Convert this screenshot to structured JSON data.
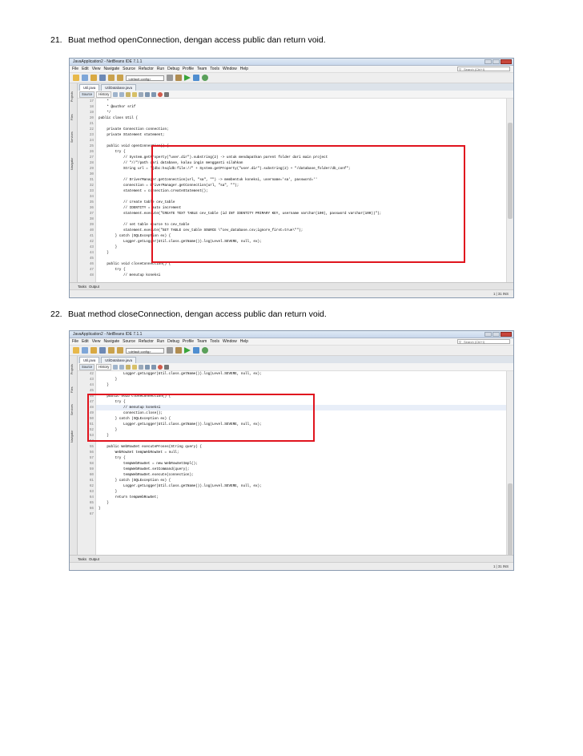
{
  "steps": [
    {
      "number": "21.",
      "text": "Buat method openConnection, dengan access public dan return void."
    },
    {
      "number": "22.",
      "text": "Buat method closeConnection, dengan access public dan return void."
    }
  ],
  "ide": {
    "title": "JavaApplication2 - NetBeans IDE 7.1.1",
    "menu": [
      "File",
      "Edit",
      "View",
      "Navigate",
      "Source",
      "Refactor",
      "Run",
      "Debug",
      "Profile",
      "Team",
      "Tools",
      "Window",
      "Help"
    ],
    "search_placeholder": "Search (Ctrl+I)",
    "config": "<default config>",
    "side_tabs": [
      "Projects",
      "Files",
      "Services",
      "Navigator"
    ],
    "editor_buttons": [
      "Source",
      "History"
    ],
    "bottom_tabs": [
      "Tasks",
      "Output"
    ],
    "colors": {
      "highlight_box": "#e0141e"
    }
  },
  "screenshot1": {
    "tabs": [
      "Util.java",
      "UtilDatabase.java"
    ],
    "status": "1 | 31  INS",
    "lines": [
      {
        "n": "17",
        "t": "    *"
      },
      {
        "n": "18",
        "t": "    * @author srif"
      },
      {
        "n": "19",
        "t": "    */"
      },
      {
        "n": "20",
        "t": "public class Util {"
      },
      {
        "n": "21",
        "t": ""
      },
      {
        "n": "22",
        "t": "    private Connection connection;"
      },
      {
        "n": "23",
        "t": "    private Statement statement;"
      },
      {
        "n": "24",
        "t": ""
      },
      {
        "n": "25",
        "t": "    public void openConnection() {"
      },
      {
        "n": "26",
        "t": "        try {"
      },
      {
        "n": "27",
        "t": "            // System.getProperty(\"user.dir\").substring(2) -> untuk mendapatkan parent folder dari main project"
      },
      {
        "n": "28",
        "t": "            // \"//\"/path dari database, kalau ingin mengganti silahkan"
      },
      {
        "n": "29",
        "t": "            String url = \"jdbc:hsqldb:file://\" + System.getProperty(\"user.dir\").substring(2) + \"/database_folder/db_conf\";"
      },
      {
        "n": "30",
        "t": ""
      },
      {
        "n": "31",
        "t": "            // DriverManager.getConnection(url, \"sa\", \"\") -> membentuk koneksi, username='sa', password=''"
      },
      {
        "n": "32",
        "t": "            connection = DriverManager.getConnection(url, \"sa\", \"\");"
      },
      {
        "n": "33",
        "t": "            statement = connection.createStatement();"
      },
      {
        "n": "34",
        "t": ""
      },
      {
        "n": "35",
        "t": "            // create table cev_table"
      },
      {
        "n": "36",
        "t": "            // IDENTITY = auto increment"
      },
      {
        "n": "37",
        "t": "            statement.execute(\"CREATE TEXT TABLE cev_table (id INT IDENTITY PRIMARY KEY, username varchar(100), password varchar(100))\");"
      },
      {
        "n": "38",
        "t": ""
      },
      {
        "n": "39",
        "t": "            // set table source to cev_table"
      },
      {
        "n": "40",
        "t": "            statement.execute(\"SET TABLE cev_table SOURCE \\\"cev_database.csv;ignore_first=true\\\"\");"
      },
      {
        "n": "41",
        "t": "        } catch (SQLException ex) {"
      },
      {
        "n": "42",
        "t": "            Logger.getLogger(Util.class.getName()).log(Level.SEVERE, null, ex);"
      },
      {
        "n": "43",
        "t": "        }"
      },
      {
        "n": "44",
        "t": "    }"
      },
      {
        "n": "45",
        "t": ""
      },
      {
        "n": "46",
        "t": "    public void closeConnection() {"
      },
      {
        "n": "47",
        "t": "        try {"
      },
      {
        "n": "48",
        "t": "            // menutup koneksi"
      }
    ]
  },
  "screenshot2": {
    "tabs": [
      "Util.java",
      "UtilDatabase.java"
    ],
    "status": "1 | 31  INS",
    "lines": [
      {
        "n": "42",
        "t": "            Logger.getLogger(Util.class.getName()).log(Level.SEVERE, null, ex);"
      },
      {
        "n": "43",
        "t": "        }"
      },
      {
        "n": "44",
        "t": "    }"
      },
      {
        "n": "45",
        "t": ""
      },
      {
        "n": "46",
        "t": "    public void closeConnection() {"
      },
      {
        "n": "47",
        "t": "        try {"
      },
      {
        "n": "48",
        "t": "            // menutup koneksi"
      },
      {
        "n": "49",
        "t": "            connection.close();"
      },
      {
        "n": "50",
        "t": "        } catch (SQLException ex) {"
      },
      {
        "n": "51",
        "t": "            Logger.getLogger(Util.class.getName()).log(Level.SEVERE, null, ex);"
      },
      {
        "n": "52",
        "t": "        }"
      },
      {
        "n": "53",
        "t": "    }"
      },
      {
        "n": "54",
        "t": ""
      },
      {
        "n": "55",
        "t": "    public WebRowSet executeProses(String query) {"
      },
      {
        "n": "56",
        "t": "        WebRowSet tempWebRowSet = null;"
      },
      {
        "n": "57",
        "t": "        try {"
      },
      {
        "n": "58",
        "t": "            tempWebRowSet = new WebRowSetImpl();"
      },
      {
        "n": "59",
        "t": "            tempWebRowSet.setCommand(query);"
      },
      {
        "n": "60",
        "t": "            tempWebRowSet.execute(connection);"
      },
      {
        "n": "61",
        "t": "        } catch (SQLException ex) {"
      },
      {
        "n": "62",
        "t": "            Logger.getLogger(Util.class.getName()).log(Level.SEVERE, null, ex);"
      },
      {
        "n": "63",
        "t": "        }"
      },
      {
        "n": "64",
        "t": "        return tempWebRowSet;"
      },
      {
        "n": "65",
        "t": "    }"
      },
      {
        "n": "66",
        "t": "}"
      },
      {
        "n": "67",
        "t": ""
      }
    ]
  }
}
